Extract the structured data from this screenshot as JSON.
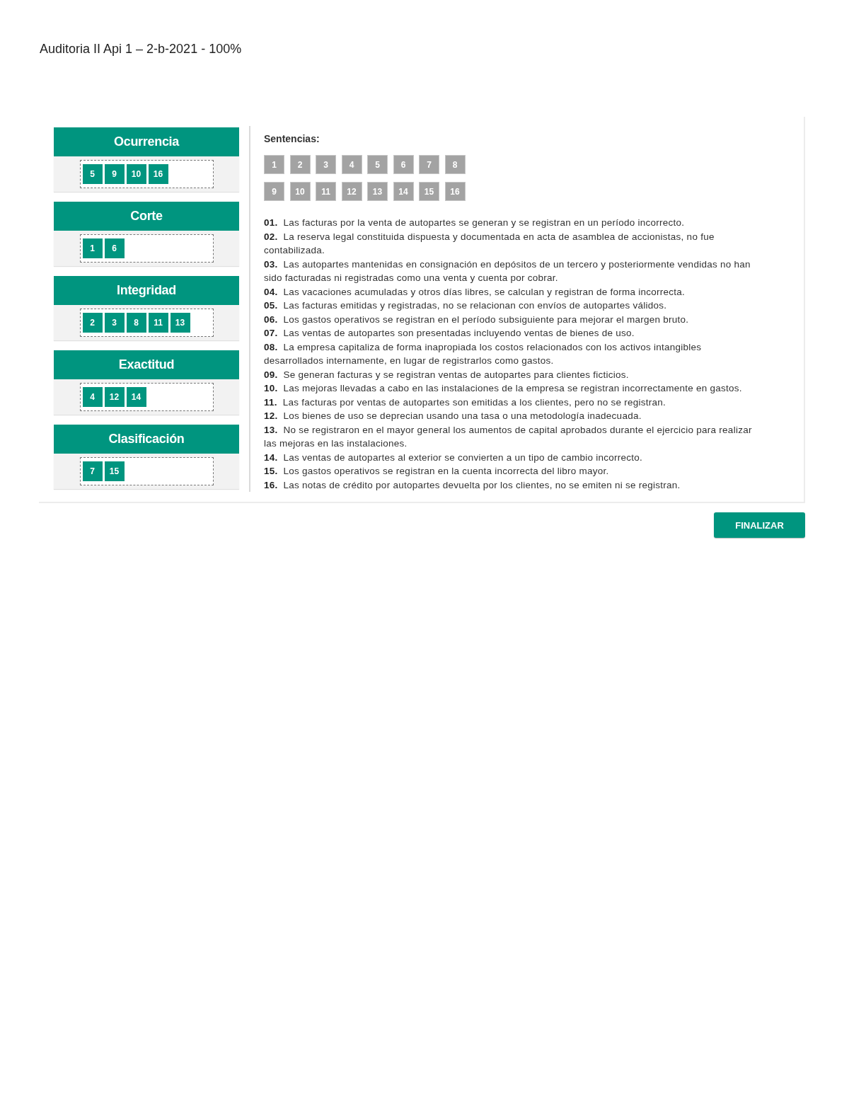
{
  "title": "Auditoria II Api 1 – 2-b-2021 - 100%",
  "categories": [
    {
      "name": "Ocurrencia",
      "items": [
        "5",
        "9",
        "10",
        "16"
      ]
    },
    {
      "name": "Corte",
      "items": [
        "1",
        "6"
      ]
    },
    {
      "name": "Integridad",
      "items": [
        "2",
        "3",
        "8",
        "11",
        "13"
      ]
    },
    {
      "name": "Exactitud",
      "items": [
        "4",
        "12",
        "14"
      ]
    },
    {
      "name": "Clasificación",
      "items": [
        "7",
        "15"
      ]
    }
  ],
  "sentences_label": "Sentencias:",
  "tiles": [
    "1",
    "2",
    "3",
    "4",
    "5",
    "6",
    "7",
    "8",
    "9",
    "10",
    "11",
    "12",
    "13",
    "14",
    "15",
    "16"
  ],
  "sentences": [
    {
      "number": "01.",
      "text": "Las facturas por la venta de autopartes se generan y se registran en un período incorrecto."
    },
    {
      "number": "02.",
      "text": "La reserva legal constituida dispuesta y documentada en acta de asamblea de accionistas, no fue contabilizada."
    },
    {
      "number": "03.",
      "text": "Las autopartes mantenidas en consignación en depósitos de un tercero y posteriormente vendidas no han sido facturadas ni registradas como una venta y cuenta por cobrar."
    },
    {
      "number": "04.",
      "text": "Las vacaciones acumuladas y otros días libres, se calculan y registran de forma incorrecta."
    },
    {
      "number": "05.",
      "text": "Las facturas emitidas y registradas, no se relacionan con envíos de autopartes válidos."
    },
    {
      "number": "06.",
      "text": "Los gastos operativos se registran en el período subsiguiente para mejorar el margen bruto."
    },
    {
      "number": "07.",
      "text": "Las ventas de autopartes son presentadas incluyendo ventas de bienes de uso."
    },
    {
      "number": "08.",
      "text": "La empresa capitaliza de forma inapropiada los costos relacionados con los activos intangibles desarrollados internamente, en lugar de registrarlos como gastos."
    },
    {
      "number": "09.",
      "text": "Se generan facturas y se registran ventas de autopartes para clientes ficticios."
    },
    {
      "number": "10.",
      "text": "Las mejoras llevadas a cabo en las instalaciones de la empresa se registran incorrectamente en gastos."
    },
    {
      "number": "11.",
      "text": "Las facturas por ventas de autopartes son emitidas a los clientes, pero no se registran."
    },
    {
      "number": "12.",
      "text": "Los bienes de uso se deprecian usando una tasa o una metodología inadecuada."
    },
    {
      "number": "13.",
      "text": "No se registraron en el mayor general los aumentos de capital aprobados durante el ejercicio para realizar las mejoras en las instalaciones."
    },
    {
      "number": "14.",
      "text": "Las ventas de autopartes al exterior se convierten a un tipo de cambio incorrecto."
    },
    {
      "number": "15.",
      "text": "Los gastos operativos se registran en la cuenta incorrecta del libro mayor."
    },
    {
      "number": "16.",
      "text": "Las notas de crédito por autopartes devuelta por los clientes, no se emiten ni se registran."
    }
  ],
  "finish_button": "FINALIZAR"
}
